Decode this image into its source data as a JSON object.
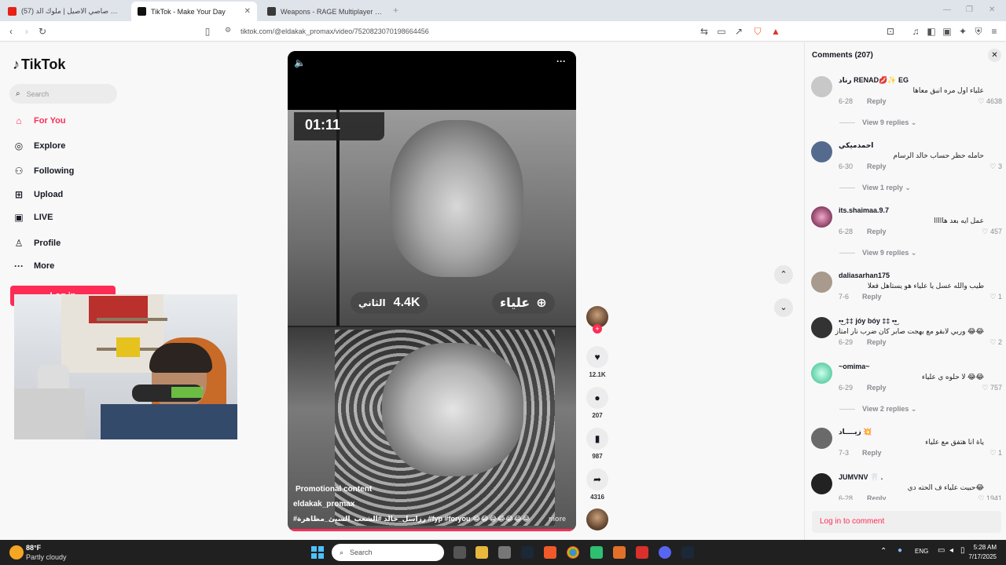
{
  "browser": {
    "tabs": [
      {
        "label": "(57) مهرجان صاصي الاصيل | ملوك الد",
        "active": false
      },
      {
        "label": "TikTok - Make Your Day",
        "active": true
      },
      {
        "label": "Weapons - RAGE Multiplayer Wiki",
        "active": false
      }
    ],
    "new_tab": "+",
    "url": "tiktok.com/@eldakak_promax/video/7520823070198664456"
  },
  "sidebar": {
    "logo": "TikTok",
    "search_placeholder": "Search",
    "nav": [
      {
        "label": "For You",
        "icon": "home-icon"
      },
      {
        "label": "Explore",
        "icon": "compass-icon"
      },
      {
        "label": "Following",
        "icon": "person-icon"
      },
      {
        "label": "Upload",
        "icon": "plus-square-icon"
      },
      {
        "label": "LIVE",
        "icon": "live-icon"
      },
      {
        "label": "Profile",
        "icon": "profile-icon"
      },
      {
        "label": "More",
        "icon": "dots-icon"
      }
    ],
    "login_label": "Log in"
  },
  "video": {
    "timer": "01:11",
    "stat_left": "4.4K",
    "label_left": "الثاني",
    "label_right": "علياء",
    "promo": "Promotional content",
    "author": "eldakak_promax",
    "caption": "#رزاسل_خالد #الشعب_السيئ_مظاهرة #fyp #foryou 😂😂😂😂😂😂😂",
    "more": "more"
  },
  "actions": {
    "likes": "12.1K",
    "comments": "207",
    "saves": "987",
    "shares": "4316"
  },
  "comments": {
    "title": "Comments (207)",
    "items": [
      {
        "name": "رناد RENAD💋✨ EG",
        "text": "علياء اول مره انبق معاها",
        "date": "6-28",
        "likes": "4638",
        "replies": "View 9 replies"
      },
      {
        "name": "احمدميكي",
        "text": "حامله حظر حساب خالد الرسام",
        "date": "6-30",
        "likes": "3",
        "replies": "View 1 reply"
      },
      {
        "name": "its.shaimaa.9.7",
        "text": "عمل ايه بعد هااااا",
        "date": "6-28",
        "likes": "457",
        "replies": "View 9 replies"
      },
      {
        "name": "daliasarhan175",
        "text": "طيب والله عسل يا علياء هو يستاهل فعلا",
        "date": "7-6",
        "likes": "1",
        "replies": ""
      },
      {
        "name": "•͜• ‡‡ jóy bóy ‡‡ •͜•",
        "text": "😂😂 وربي لابقو مع بهجت صابر كان ضرب نار امتاز",
        "date": "6-29",
        "likes": "2",
        "replies": ""
      },
      {
        "name": "~omima~",
        "text": "😂😂 لا حلوه ي علياء",
        "date": "6-29",
        "likes": "757",
        "replies": "View 2 replies"
      },
      {
        "name": "زيــــاد 💥",
        "text": "ياة انا هتفق مع علياء",
        "date": "7-3",
        "likes": "1",
        "replies": ""
      },
      {
        "name": "JUMVNV 🦷 .",
        "text": "😂حبيت علياء ف الحته دي",
        "date": "6-28",
        "likes": "1941",
        "replies": ""
      }
    ],
    "reply_label": "Reply",
    "login_prompt": "Log in to comment"
  },
  "taskbar": {
    "weather_temp": "88°F",
    "weather_desc": "Partly cloudy",
    "search_placeholder": "Search",
    "lang": "ENG",
    "time": "5:28 AM",
    "date": "7/17/2025"
  }
}
